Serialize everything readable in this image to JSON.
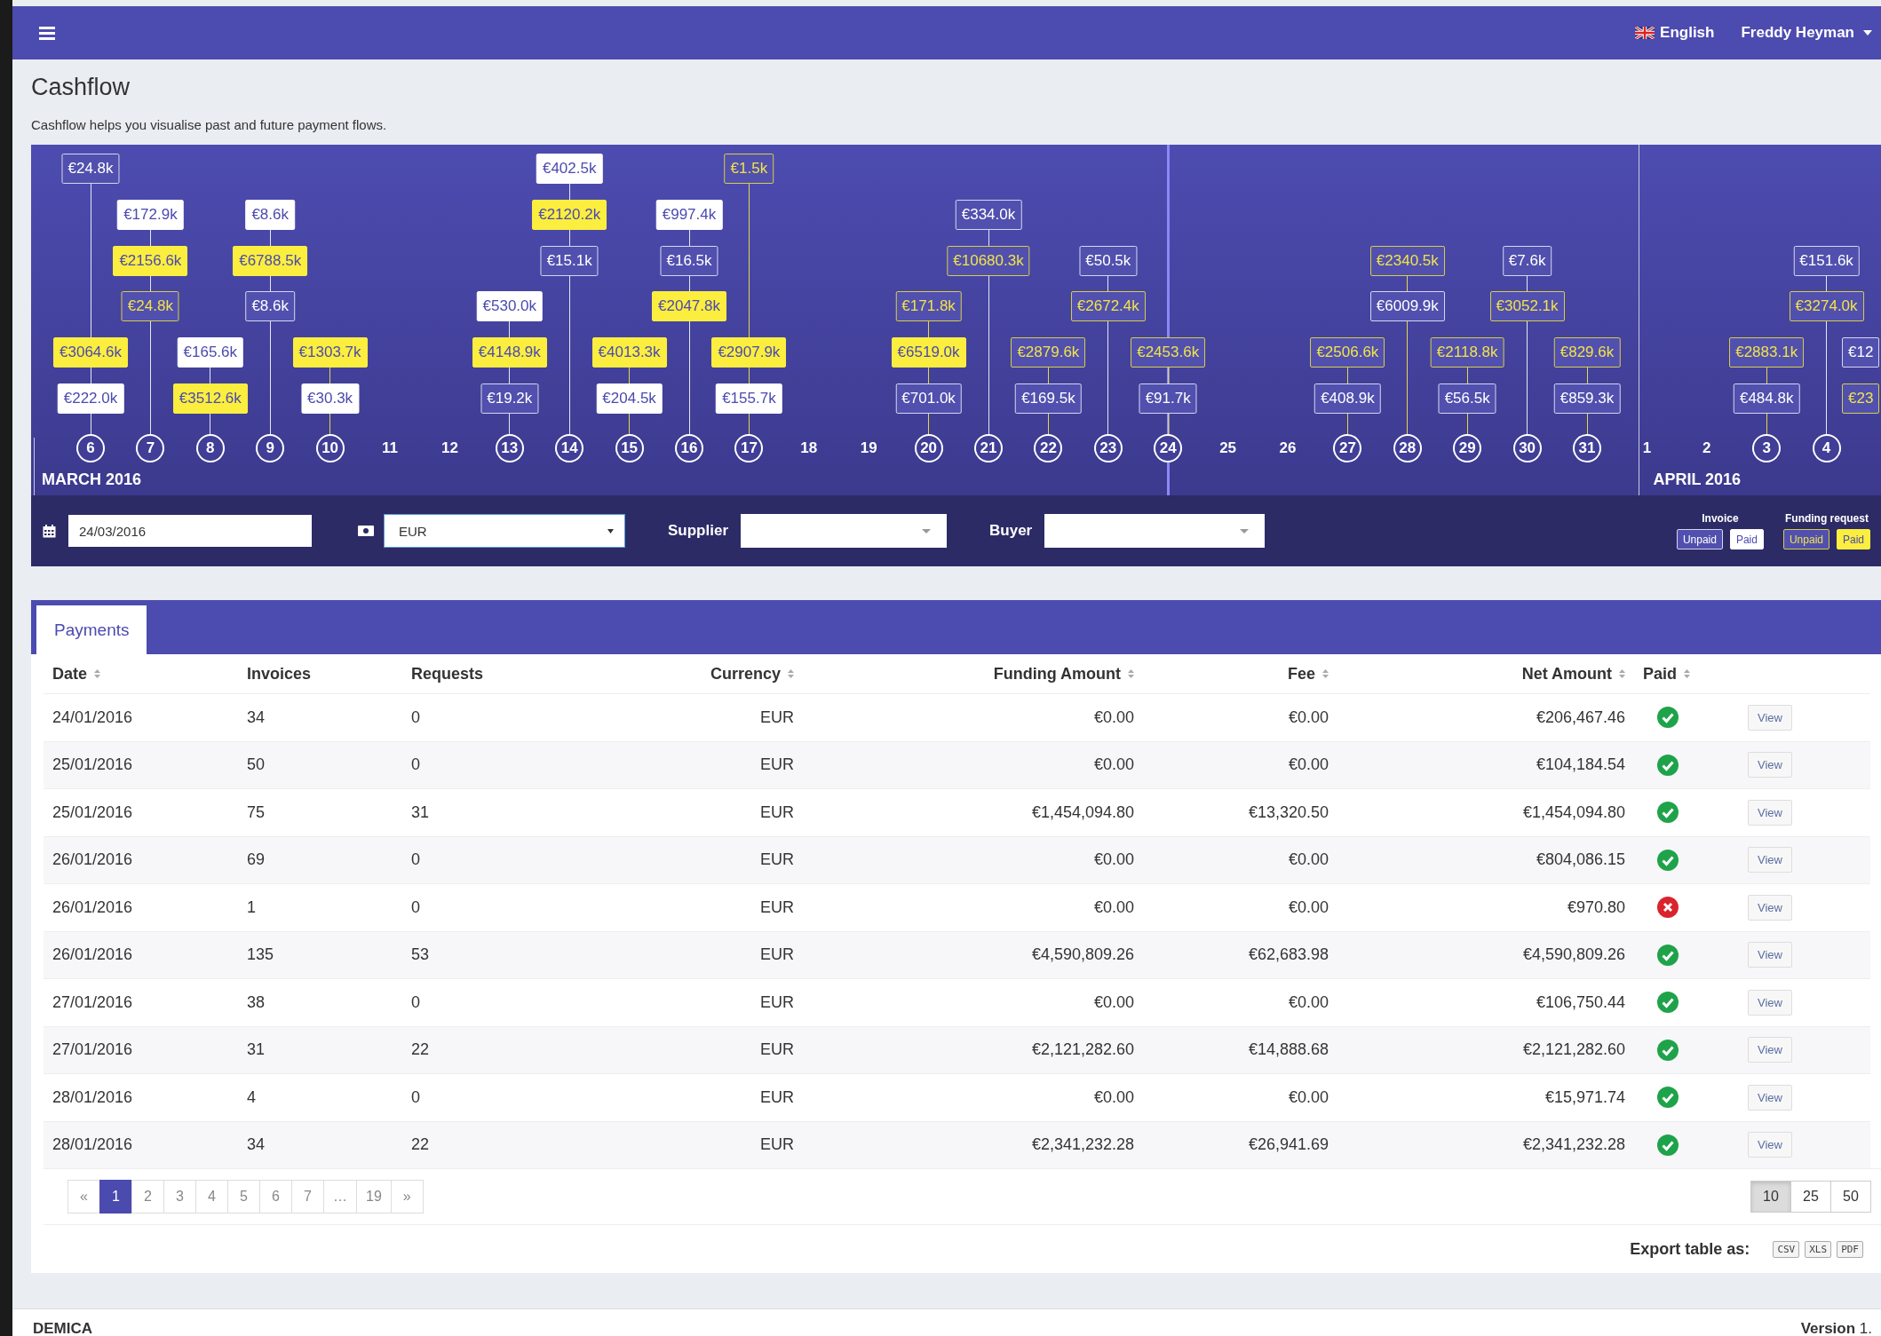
{
  "topbar": {
    "language": "English",
    "user": "Freddy Heyman"
  },
  "page": {
    "title": "Cashflow",
    "subtitle": "Cashflow helps you visualise past and future payment flows."
  },
  "timeline": {
    "months": [
      {
        "label": "MARCH 2016",
        "days": [
          {
            "label": "6",
            "today": false,
            "entries": [
              {
                "amount": "€24.8k",
                "kind": "invoice",
                "paid": false
              },
              {
                "amount": "€3064.6k",
                "kind": "funding",
                "paid": true
              },
              {
                "amount": "€222.0k",
                "kind": "invoice",
                "paid": true
              }
            ]
          },
          {
            "label": "7",
            "today": false,
            "entries": [
              {
                "amount": "€172.9k",
                "kind": "invoice",
                "paid": true
              },
              {
                "amount": "€2156.6k",
                "kind": "funding",
                "paid": true
              },
              {
                "amount": "€24.8k",
                "kind": "funding",
                "paid": false
              }
            ]
          },
          {
            "label": "8",
            "today": false,
            "entries": [
              {
                "amount": "€165.6k",
                "kind": "invoice",
                "paid": true
              },
              {
                "amount": "€3512.6k",
                "kind": "funding",
                "paid": true
              }
            ]
          },
          {
            "label": "9",
            "today": false,
            "entries": [
              {
                "amount": "€8.6k",
                "kind": "invoice",
                "paid": true
              },
              {
                "amount": "€6788.5k",
                "kind": "funding",
                "paid": true
              },
              {
                "amount": "€8.6k",
                "kind": "invoice",
                "paid": false
              }
            ]
          },
          {
            "label": "10",
            "today": false,
            "entries": [
              {
                "amount": "€1303.7k",
                "kind": "funding",
                "paid": true
              },
              {
                "amount": "€30.3k",
                "kind": "invoice",
                "paid": true
              }
            ]
          },
          {
            "label": "11",
            "today": false
          },
          {
            "label": "12",
            "today": false
          },
          {
            "label": "13",
            "today": false,
            "entries": [
              {
                "amount": "€530.0k",
                "kind": "invoice",
                "paid": true
              },
              {
                "amount": "€4148.9k",
                "kind": "funding",
                "paid": true
              },
              {
                "amount": "€19.2k",
                "kind": "invoice",
                "paid": false
              }
            ]
          },
          {
            "label": "14",
            "today": false,
            "entries": [
              {
                "amount": "€402.5k",
                "kind": "invoice",
                "paid": true
              },
              {
                "amount": "€2120.2k",
                "kind": "funding",
                "paid": true
              },
              {
                "amount": "€15.1k",
                "kind": "invoice",
                "paid": false
              }
            ]
          },
          {
            "label": "15",
            "today": false,
            "entries": [
              {
                "amount": "€4013.3k",
                "kind": "funding",
                "paid": true
              },
              {
                "amount": "€204.5k",
                "kind": "invoice",
                "paid": true
              }
            ]
          },
          {
            "label": "16",
            "today": false,
            "entries": [
              {
                "amount": "€997.4k",
                "kind": "invoice",
                "paid": true
              },
              {
                "amount": "€16.5k",
                "kind": "invoice",
                "paid": false
              },
              {
                "amount": "€2047.8k",
                "kind": "funding",
                "paid": true
              }
            ]
          },
          {
            "label": "17",
            "today": false,
            "entries": [
              {
                "amount": "€1.5k",
                "kind": "funding",
                "paid": false
              },
              {
                "amount": "€2907.9k",
                "kind": "funding",
                "paid": true
              },
              {
                "amount": "€155.7k",
                "kind": "invoice",
                "paid": true
              }
            ]
          },
          {
            "label": "18",
            "today": false
          },
          {
            "label": "19",
            "today": false
          },
          {
            "label": "20",
            "today": false,
            "entries": [
              {
                "amount": "€171.8k",
                "kind": "funding",
                "paid": false
              },
              {
                "amount": "€6519.0k",
                "kind": "funding",
                "paid": true
              },
              {
                "amount": "€701.0k",
                "kind": "invoice",
                "paid": false
              }
            ]
          },
          {
            "label": "21",
            "today": false,
            "entries": [
              {
                "amount": "€334.0k",
                "kind": "invoice",
                "paid": false
              },
              {
                "amount": "€10680.3k",
                "kind": "funding",
                "paid": false
              }
            ]
          },
          {
            "label": "22",
            "today": false,
            "entries": [
              {
                "amount": "€2879.6k",
                "kind": "funding",
                "paid": false
              },
              {
                "amount": "€169.5k",
                "kind": "invoice",
                "paid": false
              }
            ]
          },
          {
            "label": "23",
            "today": false,
            "entries": [
              {
                "amount": "€50.5k",
                "kind": "invoice",
                "paid": false
              },
              {
                "amount": "€2672.4k",
                "kind": "funding",
                "paid": false
              }
            ]
          },
          {
            "label": "24",
            "today": true,
            "entries": [
              {
                "amount": "€2453.6k",
                "kind": "funding",
                "paid": false
              },
              {
                "amount": "€91.7k",
                "kind": "invoice",
                "paid": false
              }
            ]
          },
          {
            "label": "25",
            "today": false
          },
          {
            "label": "26",
            "today": false
          },
          {
            "label": "27",
            "today": false,
            "entries": [
              {
                "amount": "€2506.6k",
                "kind": "funding",
                "paid": false
              },
              {
                "amount": "€408.9k",
                "kind": "invoice",
                "paid": false
              }
            ]
          },
          {
            "label": "28",
            "today": false,
            "entries": [
              {
                "amount": "€2340.5k",
                "kind": "funding",
                "paid": false
              },
              {
                "amount": "€6009.9k",
                "kind": "invoice",
                "paid": false
              }
            ]
          },
          {
            "label": "29",
            "today": false,
            "entries": [
              {
                "amount": "€2118.8k",
                "kind": "funding",
                "paid": false
              },
              {
                "amount": "€56.5k",
                "kind": "invoice",
                "paid": false
              }
            ]
          },
          {
            "label": "30",
            "today": false,
            "entries": [
              {
                "amount": "€7.6k",
                "kind": "invoice",
                "paid": false
              },
              {
                "amount": "€3052.1k",
                "kind": "funding",
                "paid": false
              }
            ]
          },
          {
            "label": "31",
            "today": false,
            "entries": [
              {
                "amount": "€829.6k",
                "kind": "funding",
                "paid": false
              },
              {
                "amount": "€859.3k",
                "kind": "invoice",
                "paid": false
              }
            ]
          }
        ]
      },
      {
        "label": "APRIL 2016",
        "days": [
          {
            "label": "1",
            "today": false
          },
          {
            "label": "2",
            "today": false
          },
          {
            "label": "3",
            "today": false,
            "entries": [
              {
                "amount": "€2883.1k",
                "kind": "funding",
                "paid": false
              },
              {
                "amount": "€484.8k",
                "kind": "invoice",
                "paid": false
              }
            ]
          },
          {
            "label": "4",
            "today": false,
            "entries": [
              {
                "amount": "€151.6k",
                "kind": "invoice",
                "paid": false
              },
              {
                "amount": "€3274.0k",
                "kind": "funding",
                "paid": false
              }
            ]
          },
          {
            "entries": [
              {
                "amount": "€12",
                "kind": "invoice",
                "paid": false
              },
              {
                "amount": "€23",
                "kind": "funding",
                "paid": false
              }
            ]
          }
        ]
      }
    ]
  },
  "filters": {
    "date": "24/03/2016",
    "currency": "EUR",
    "supplier_label": "Supplier",
    "buyer_label": "Buyer"
  },
  "legend": [
    {
      "title": "Invoice",
      "kind": "invoice",
      "items": [
        {
          "label": "Unpaid",
          "paid": false
        },
        {
          "label": "Paid",
          "paid": true
        }
      ]
    },
    {
      "title": "Funding request",
      "kind": "funding",
      "items": [
        {
          "label": "Unpaid",
          "paid": false
        },
        {
          "label": "Paid",
          "paid": true
        }
      ]
    }
  ],
  "payments": {
    "tabs": [
      {
        "label": "Payments",
        "selected": true
      }
    ],
    "columns": [
      {
        "label": "Date",
        "sortable": true
      },
      {
        "label": "Invoices",
        "sortable": false
      },
      {
        "label": "Requests",
        "sortable": false
      },
      {
        "label": "Currency",
        "sortable": true
      },
      {
        "label": "Funding Amount",
        "sortable": true
      },
      {
        "label": "Fee",
        "sortable": true
      },
      {
        "label": "Net Amount",
        "sortable": true
      },
      {
        "label": "Paid",
        "sortable": true
      }
    ],
    "rows": [
      {
        "date": "24/01/2016",
        "invoices": "34",
        "requests": "0",
        "currency": "EUR",
        "funding_amount": "€0.00",
        "fee": "€0.00",
        "net_amount": "€206,467.46",
        "paid": true,
        "action": "View"
      },
      {
        "date": "25/01/2016",
        "invoices": "50",
        "requests": "0",
        "currency": "EUR",
        "funding_amount": "€0.00",
        "fee": "€0.00",
        "net_amount": "€104,184.54",
        "paid": true,
        "action": "View"
      },
      {
        "date": "25/01/2016",
        "invoices": "75",
        "requests": "31",
        "currency": "EUR",
        "funding_amount": "€1,454,094.80",
        "fee": "€13,320.50",
        "net_amount": "€1,454,094.80",
        "paid": true,
        "action": "View"
      },
      {
        "date": "26/01/2016",
        "invoices": "69",
        "requests": "0",
        "currency": "EUR",
        "funding_amount": "€0.00",
        "fee": "€0.00",
        "net_amount": "€804,086.15",
        "paid": true,
        "action": "View"
      },
      {
        "date": "26/01/2016",
        "invoices": "1",
        "requests": "0",
        "currency": "EUR",
        "funding_amount": "€0.00",
        "fee": "€0.00",
        "net_amount": "€970.80",
        "paid": false,
        "action": "View"
      },
      {
        "date": "26/01/2016",
        "invoices": "135",
        "requests": "53",
        "currency": "EUR",
        "funding_amount": "€4,590,809.26",
        "fee": "€62,683.98",
        "net_amount": "€4,590,809.26",
        "paid": true,
        "action": "View"
      },
      {
        "date": "27/01/2016",
        "invoices": "38",
        "requests": "0",
        "currency": "EUR",
        "funding_amount": "€0.00",
        "fee": "€0.00",
        "net_amount": "€106,750.44",
        "paid": true,
        "action": "View"
      },
      {
        "date": "27/01/2016",
        "invoices": "31",
        "requests": "22",
        "currency": "EUR",
        "funding_amount": "€2,121,282.60",
        "fee": "€14,888.68",
        "net_amount": "€2,121,282.60",
        "paid": true,
        "action": "View"
      },
      {
        "date": "28/01/2016",
        "invoices": "4",
        "requests": "0",
        "currency": "EUR",
        "funding_amount": "€0.00",
        "fee": "€0.00",
        "net_amount": "€15,971.74",
        "paid": true,
        "action": "View"
      },
      {
        "date": "28/01/2016",
        "invoices": "34",
        "requests": "22",
        "currency": "EUR",
        "funding_amount": "€2,341,232.28",
        "fee": "€26,941.69",
        "net_amount": "€2,341,232.28",
        "paid": true,
        "action": "View"
      }
    ],
    "pagination": {
      "prev": "«",
      "pages": [
        {
          "label": "1",
          "selected": true
        },
        {
          "label": "2",
          "selected": false
        },
        {
          "label": "3",
          "selected": false
        },
        {
          "label": "4",
          "selected": false
        },
        {
          "label": "5",
          "selected": false
        },
        {
          "label": "6",
          "selected": false
        },
        {
          "label": "7",
          "selected": false
        },
        {
          "label": "…",
          "selected": false
        },
        {
          "label": "19",
          "selected": false
        }
      ],
      "next": "»"
    },
    "page_sizes": [
      {
        "label": "10",
        "selected": true
      },
      {
        "label": "25",
        "selected": false
      },
      {
        "label": "50",
        "selected": false
      }
    ],
    "export": {
      "label": "Export table as:",
      "formats": [
        "CSV",
        "XLS",
        "PDF"
      ]
    }
  },
  "footer": {
    "brand": "DEMICA",
    "version": "**Version** 1."
  }
}
